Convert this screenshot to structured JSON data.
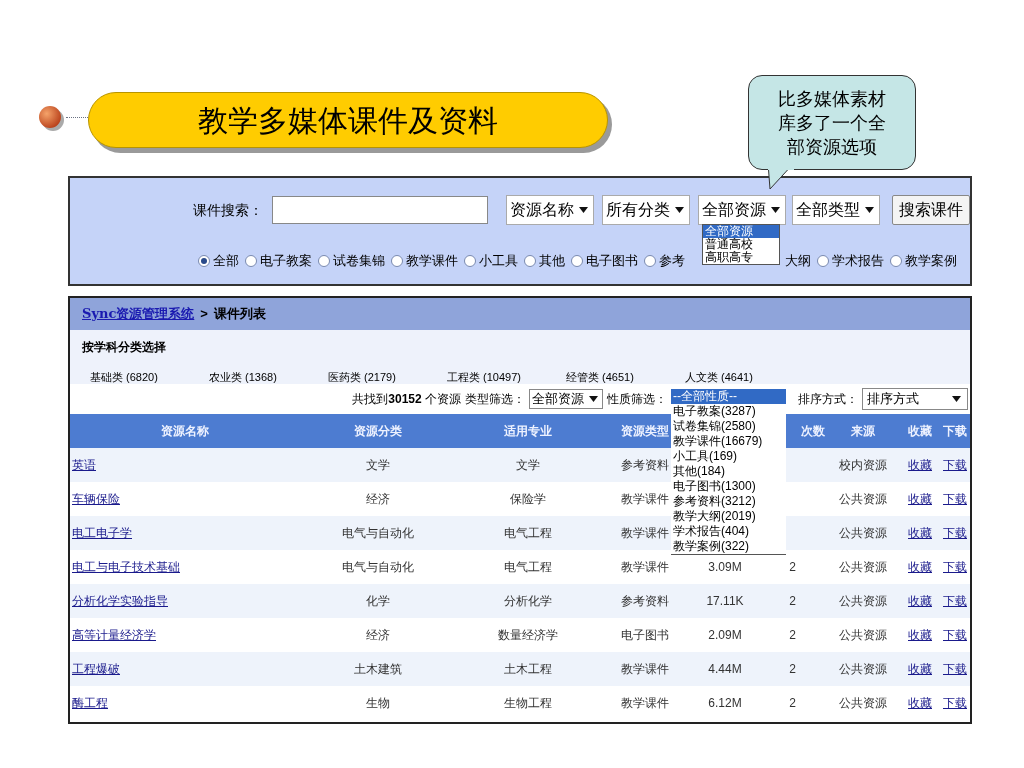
{
  "title": "教学多媒体课件及资料",
  "callout": "比多媒体素材库多了一个全部资源选项",
  "search_panel": {
    "label": "课件搜索：",
    "selects": [
      {
        "value": "资源名称"
      },
      {
        "value": "所有分类"
      },
      {
        "value": "全部资源",
        "open": true,
        "options": [
          {
            "label": "全部资源",
            "selected": true
          },
          {
            "label": "普通高校",
            "selected": false
          },
          {
            "label": "高职高专",
            "selected": false
          }
        ]
      },
      {
        "value": "全部类型"
      }
    ],
    "button": "搜索课件",
    "radios": [
      {
        "kind": "radio",
        "label": "全部",
        "checked": true
      },
      {
        "kind": "radio",
        "label": "电子教案",
        "checked": false
      },
      {
        "kind": "radio",
        "label": "试卷集锦",
        "checked": false
      },
      {
        "kind": "radio",
        "label": "教学课件",
        "checked": false
      },
      {
        "kind": "radio",
        "label": "小工具",
        "checked": false
      },
      {
        "kind": "radio",
        "label": "其他",
        "checked": false
      },
      {
        "kind": "radio",
        "label": "电子图书",
        "checked": false
      },
      {
        "kind": "radio",
        "label": "参考",
        "checked": false
      },
      {
        "kind": "cut",
        "label": "大纲"
      },
      {
        "kind": "radio",
        "label": "学术报告",
        "checked": false
      },
      {
        "kind": "radio",
        "label": "教学案例",
        "checked": false
      }
    ]
  },
  "list_panel": {
    "breadcrumb": {
      "link": "Sync资源管理系统",
      "separator": ">",
      "current": "课件列表"
    },
    "subject_filter": {
      "heading": "按学科分类选择",
      "items": [
        "基础类 (6820)",
        "农业类 (1368)",
        "医药类 (2179)",
        "工程类 (10497)",
        "经管类 (4651)",
        "人文类 (4641)"
      ]
    },
    "toolbar": {
      "summary": "共找到**30152** 个资源",
      "type_filter": {
        "label": "类型筛选：",
        "value": "全部资源"
      },
      "nature_filter": {
        "label": "性质筛选：",
        "open": true,
        "options": [
          {
            "label": "--全部性质--",
            "selected": true
          },
          {
            "label": "电子教案(3287)",
            "selected": false
          },
          {
            "label": "试卷集锦(2580)",
            "selected": false
          },
          {
            "label": "教学课件(16679)",
            "selected": false
          },
          {
            "label": "小工具(169)",
            "selected": false
          },
          {
            "label": "其他(184)",
            "selected": false
          },
          {
            "label": "电子图书(1300)",
            "selected": false
          },
          {
            "label": "参考资料(3212)",
            "selected": false
          },
          {
            "label": "教学大纲(2019)",
            "selected": false
          },
          {
            "label": "学术报告(404)",
            "selected": false
          },
          {
            "label": "教学案例(322)",
            "selected": false
          }
        ]
      },
      "sort": {
        "label": "排序方式：",
        "value": "排序方式"
      }
    },
    "table": {
      "columns": {
        "name": "资源名称",
        "category": "资源分类",
        "major": "适用专业",
        "type": "资源类型",
        "count": "次数",
        "source": "来源",
        "favorite": "收藏",
        "download": "下载"
      },
      "rows": [
        {
          "name": "英语",
          "category": "文学",
          "major": "文学",
          "type": "参考资料",
          "source": "校内资源",
          "favorite": "收藏",
          "download": "下载"
        },
        {
          "name": "车辆保险",
          "category": "经济",
          "major": "保险学",
          "type": "教学课件",
          "source": "公共资源",
          "favorite": "收藏",
          "download": "下载"
        },
        {
          "name": "电工电子学",
          "category": "电气与自动化",
          "major": "电气工程",
          "type": "教学课件",
          "source": "公共资源",
          "favorite": "收藏",
          "download": "下载"
        },
        {
          "name": "电工与电子技术基础",
          "category": "电气与自动化",
          "major": "电气工程",
          "type": "教学课件",
          "size": "3.09M",
          "count": "2",
          "source": "公共资源",
          "favorite": "收藏",
          "download": "下载"
        },
        {
          "name": "分析化学实验指导",
          "category": "化学",
          "major": "分析化学",
          "type": "参考资料",
          "size": "17.11K",
          "count": "2",
          "source": "公共资源",
          "favorite": "收藏",
          "download": "下载"
        },
        {
          "name": "高等计量经济学",
          "category": "经济",
          "major": "数量经济学",
          "type": "电子图书",
          "size": "2.09M",
          "count": "2",
          "source": "公共资源",
          "favorite": "收藏",
          "download": "下载"
        },
        {
          "name": "工程爆破",
          "category": "土木建筑",
          "major": "土木工程",
          "type": "教学课件",
          "size": "4.44M",
          "count": "2",
          "source": "公共资源",
          "favorite": "收藏",
          "download": "下载"
        },
        {
          "name": "酶工程",
          "category": "生物",
          "major": "生物工程",
          "type": "教学课件",
          "size": "6.12M",
          "count": "2",
          "source": "公共资源",
          "favorite": "收藏",
          "download": "下载"
        }
      ]
    }
  }
}
